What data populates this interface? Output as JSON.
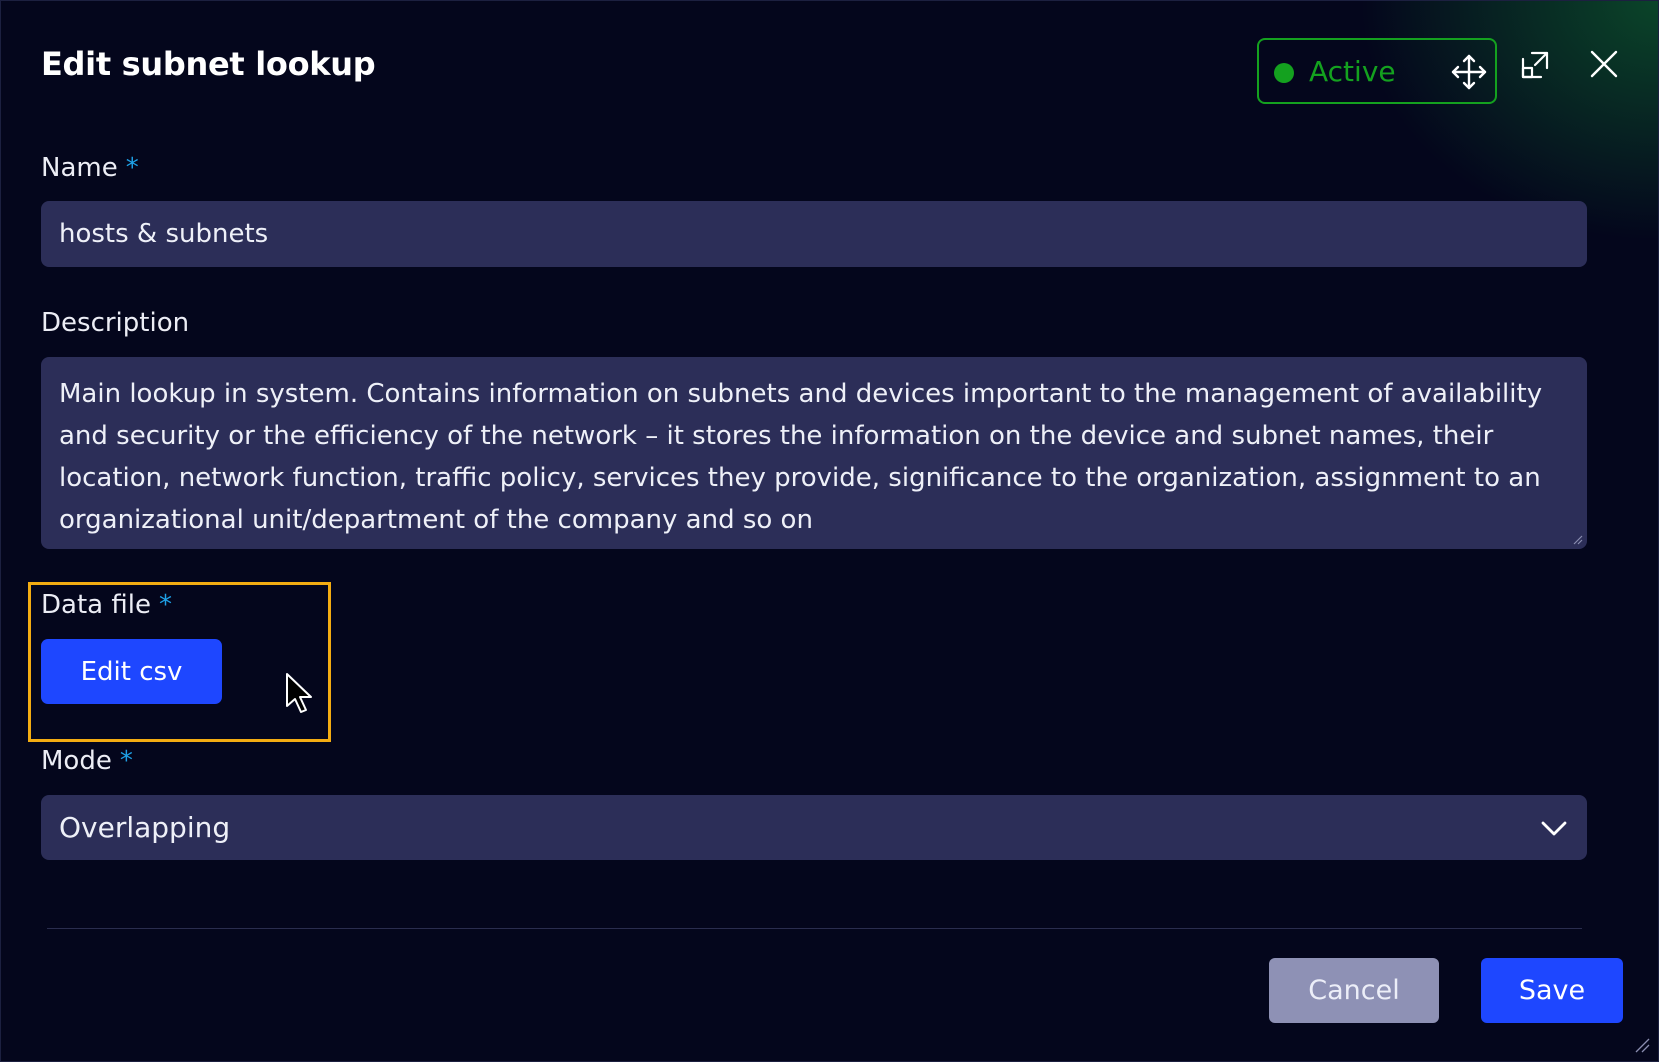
{
  "dialog": {
    "title": "Edit subnet lookup",
    "status": {
      "label": "Active",
      "color": "#14a11f"
    },
    "icons": {
      "move": "move-arrows-icon",
      "expand": "expand-icon",
      "close": "close-icon"
    }
  },
  "form": {
    "name": {
      "label": "Name",
      "required_mark": "*",
      "value": "hosts & subnets"
    },
    "description": {
      "label": "Description",
      "value": "Main lookup in system. Contains information on subnets and devices important to the management of availability and security or the efficiency of the network – it stores the information on the device and subnet names, their location, network function, traffic policy, services they provide, significance to the organization, assignment to an organizational unit/department of the company and so on"
    },
    "data_file": {
      "label": "Data file",
      "required_mark": "*",
      "button_label": "Edit csv"
    },
    "mode": {
      "label": "Mode",
      "required_mark": "*",
      "selected": "Overlapping"
    }
  },
  "footer": {
    "cancel_label": "Cancel",
    "save_label": "Save"
  },
  "colors": {
    "background": "#04061c",
    "input": "#2c2e58",
    "primary": "#1e47ff",
    "required": "#1ea0e6",
    "highlight": "#f3ac12",
    "cancel": "#8e91b5"
  }
}
